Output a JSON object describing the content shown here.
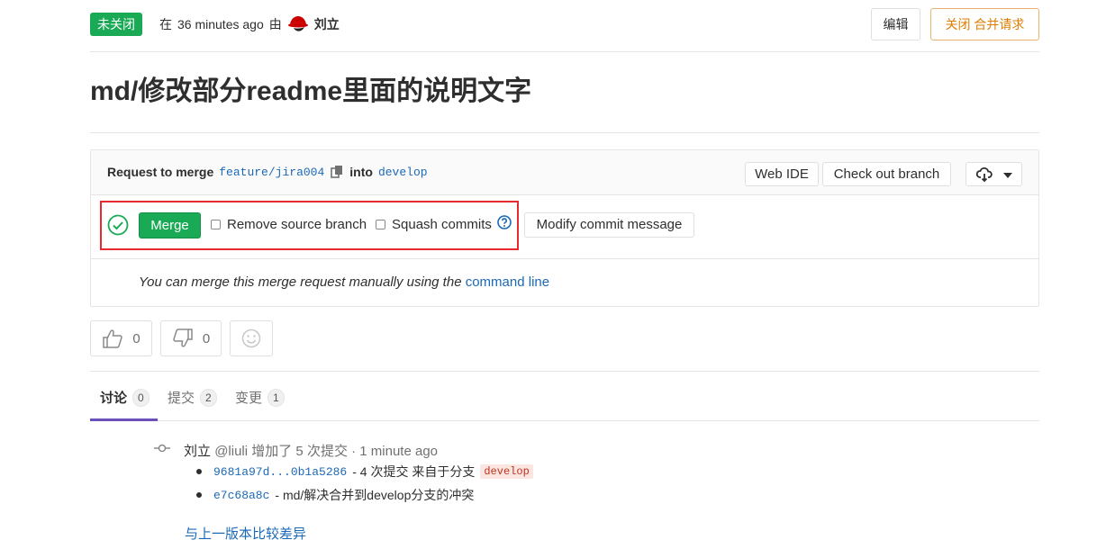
{
  "header": {
    "status": "未关闭",
    "time_prefix": "在",
    "time": "36 minutes ago",
    "by": "由",
    "author": "刘立",
    "edit_label": "编辑",
    "close_label": "关闭 合并请求"
  },
  "title": "md/修改部分readme里面的说明文字",
  "widget": {
    "request_label": "Request to merge",
    "source_branch": "feature/jira004",
    "into_label": "into",
    "target_branch": "develop",
    "web_ide_label": "Web IDE",
    "checkout_label": "Check out branch",
    "merge_label": "Merge",
    "remove_source_label": "Remove source branch",
    "remove_source_checked": false,
    "squash_label": "Squash commits",
    "squash_checked": false,
    "modify_label": "Modify commit message",
    "manual_text": "You can merge this merge request manually using the",
    "command_line_link": "command line"
  },
  "awards": {
    "thumbsup_count": "0",
    "thumbsdown_count": "0"
  },
  "tabs": [
    {
      "label": "讨论",
      "count": "0"
    },
    {
      "label": "提交",
      "count": "2"
    },
    {
      "label": "变更",
      "count": "1"
    }
  ],
  "activity": {
    "author": "刘立",
    "handle": "@liuli",
    "action": "增加了 5 次提交 · 1 minute ago",
    "commits": [
      {
        "sha": "9681a97d...0b1a5286",
        "text": "- 4 次提交 来自于分支",
        "tag": "develop"
      },
      {
        "sha": "e7c68a8c",
        "text": "- md/解决合并到develop分支的冲突"
      }
    ],
    "compare_link": "与上一版本比较差异"
  },
  "colors": {
    "success": "#1aaa55",
    "link": "#1b69b6",
    "warning": "#de7e00",
    "highlight_box": "#e8292f",
    "tab_active": "#6b4fbb"
  }
}
